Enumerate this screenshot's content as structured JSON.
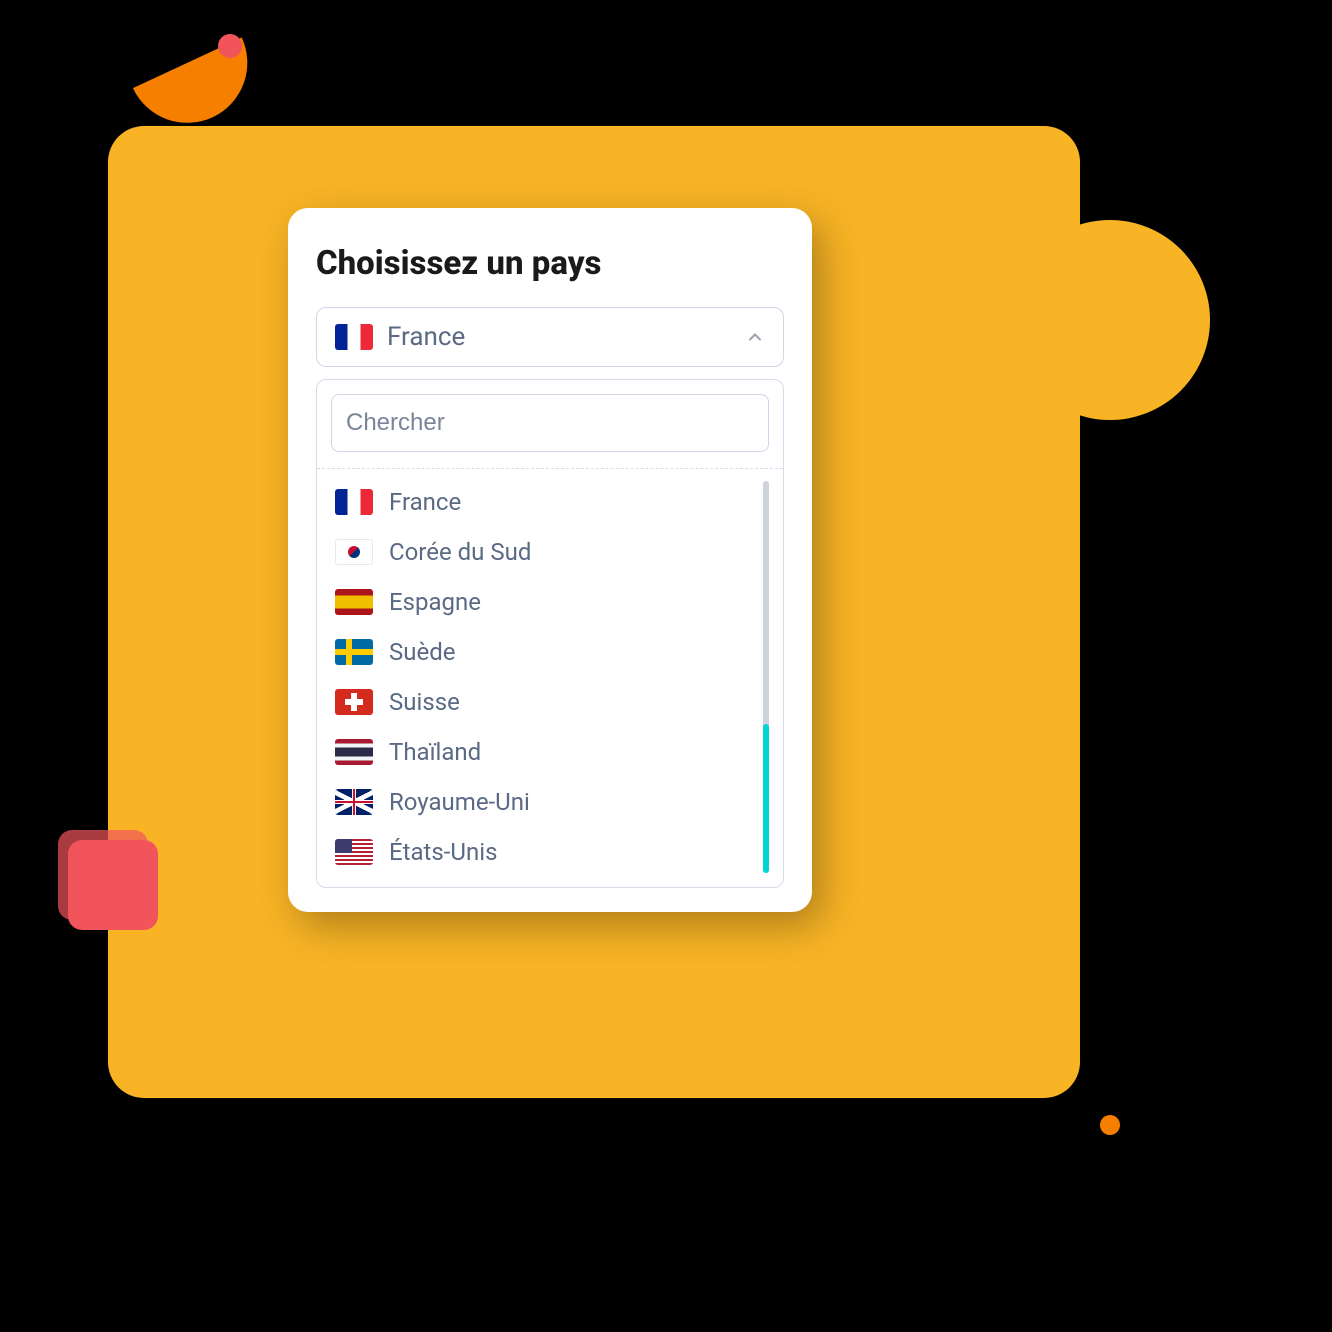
{
  "title": "Choisissez un pays",
  "selected": {
    "label": "France",
    "flag": "fr"
  },
  "search": {
    "placeholder": "Chercher",
    "value": ""
  },
  "options": [
    {
      "label": "France",
      "flag": "fr"
    },
    {
      "label": "Corée du Sud",
      "flag": "kr"
    },
    {
      "label": "Espagne",
      "flag": "es"
    },
    {
      "label": "Suède",
      "flag": "se"
    },
    {
      "label": "Suisse",
      "flag": "ch"
    },
    {
      "label": "Thaïland",
      "flag": "th"
    },
    {
      "label": "Royaume-Uni",
      "flag": "uk"
    },
    {
      "label": "États-Unis",
      "flag": "us"
    }
  ],
  "colors": {
    "accent": "#00D4D4",
    "bgSquare": "#F8B425",
    "orange": "#F77F00",
    "red": "#F2545B"
  }
}
